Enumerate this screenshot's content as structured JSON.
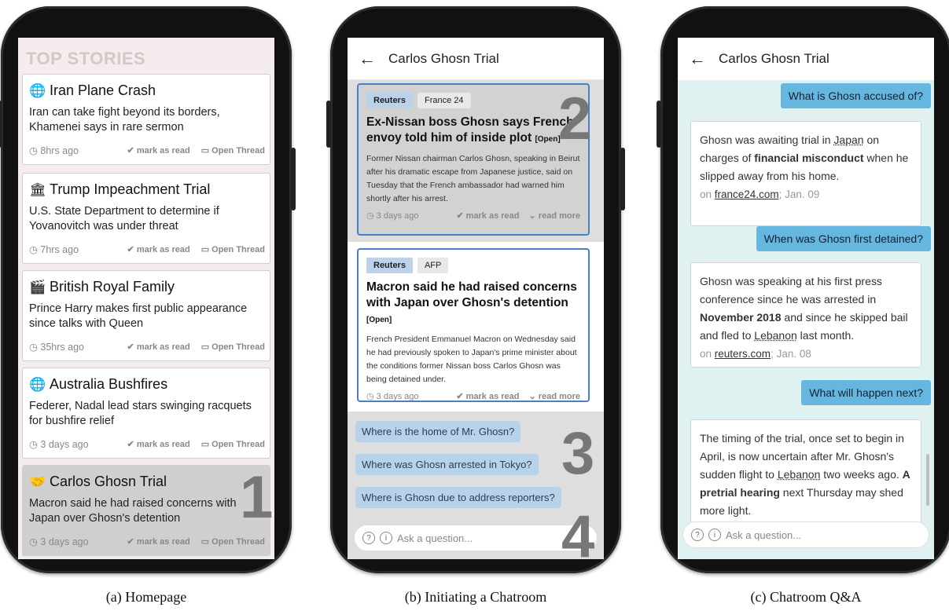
{
  "homepage": {
    "section_title": "TOP STORIES",
    "mark_label": "mark as read",
    "thread_label": "Open Thread",
    "cards": [
      {
        "icon": "globe-icon",
        "glyph": "🌐",
        "title": "Iran Plane Crash",
        "desc": "Iran can take fight beyond its borders, Khamenei says in rare sermon",
        "time": "8hrs ago"
      },
      {
        "icon": "government-icon",
        "glyph": "🏛",
        "title": "Trump Impeachment Trial",
        "desc": "U.S. State Department to determine if Yovanovitch was under threat",
        "time": "7hrs ago"
      },
      {
        "icon": "clapper-icon",
        "glyph": "🎬",
        "title": "British Royal Family",
        "desc": "Prince Harry makes first public appearance since talks with Queen",
        "time": "35hrs ago"
      },
      {
        "icon": "globe-icon",
        "glyph": "🌐",
        "title": "Australia Bushfires",
        "desc": "Federer, Nadal lead stars swinging racquets for bushfire relief",
        "time": "3 days ago"
      },
      {
        "icon": "handshake-icon",
        "glyph": "🤝",
        "title": "Carlos Ghosn Trial",
        "desc": "Macron said he had raised concerns with Japan over Ghosn's detention",
        "time": "3 days ago"
      }
    ],
    "number": "1"
  },
  "chatroom": {
    "title": "Carlos Ghosn Trial",
    "articles": [
      {
        "tags": [
          "Reuters",
          "France 24"
        ],
        "title": "Ex-Nissan boss Ghosn says French envoy told him of inside plot",
        "open": "[Open]",
        "body": "Former Nissan chairman Carlos Ghosn, speaking in Beirut after his dramatic escape from Japanese justice, said on Tuesday that the French ambassador had warned him shortly after his arrest.",
        "time": "3 days ago"
      },
      {
        "tags": [
          "Reuters",
          "AFP"
        ],
        "title": "Macron said he had raised concerns with Japan over Ghosn's detention",
        "open": "[Open]",
        "body": "French President Emmanuel Macron on Wednesday said he had previously spoken to Japan's prime minister about the conditions former Nissan boss Carlos Ghosn was being detained under.",
        "time": "3 days ago"
      }
    ],
    "mark_label": "mark as read",
    "read_more": "read more",
    "suggestions": [
      "Where is the home of Mr. Ghosn?",
      "Where was Ghosn arrested in Tokyo?",
      "Where is Ghosn due to address reporters?"
    ],
    "ask_placeholder": "Ask a question...",
    "numbers": [
      "2",
      "3",
      "4"
    ]
  },
  "qa": {
    "title": "Carlos Ghosn Trial",
    "questions": [
      "What is Ghosn accused of?",
      "When was Ghosn first detained?",
      "What will happen next?"
    ],
    "answers": [
      {
        "pre": "Ghosn was awaiting trial in ",
        "link": "Japan",
        "mid": " on charges of ",
        "bold": "financial misconduct",
        "post": " when he slipped away from his home.",
        "src_pre": "on ",
        "src": "france24.com",
        "date": "; Jan. 09"
      },
      {
        "pre": "Ghosn was speaking at his first press conference since he was arrested in ",
        "bold": "November 2018",
        "mid": " and since he skipped bail and fled to ",
        "link": "Lebanon",
        "post": " last month.",
        "src_pre": "on ",
        "src": "reuters.com",
        "date": "; Jan. 08"
      },
      {
        "pre": "The timing of the trial, once set to begin in April, is now uncertain after Mr. Ghosn's sudden flight to ",
        "link": "Lebanon",
        "mid": " two weeks ago. ",
        "bold": "A pretrial hearing",
        "post": " next Thursday may shed more light."
      }
    ],
    "ask_placeholder": "Ask a question..."
  },
  "captions": [
    "(a)  Homepage",
    "(b)  Initiating a Chatroom",
    "(c)  Chatroom Q&A"
  ]
}
